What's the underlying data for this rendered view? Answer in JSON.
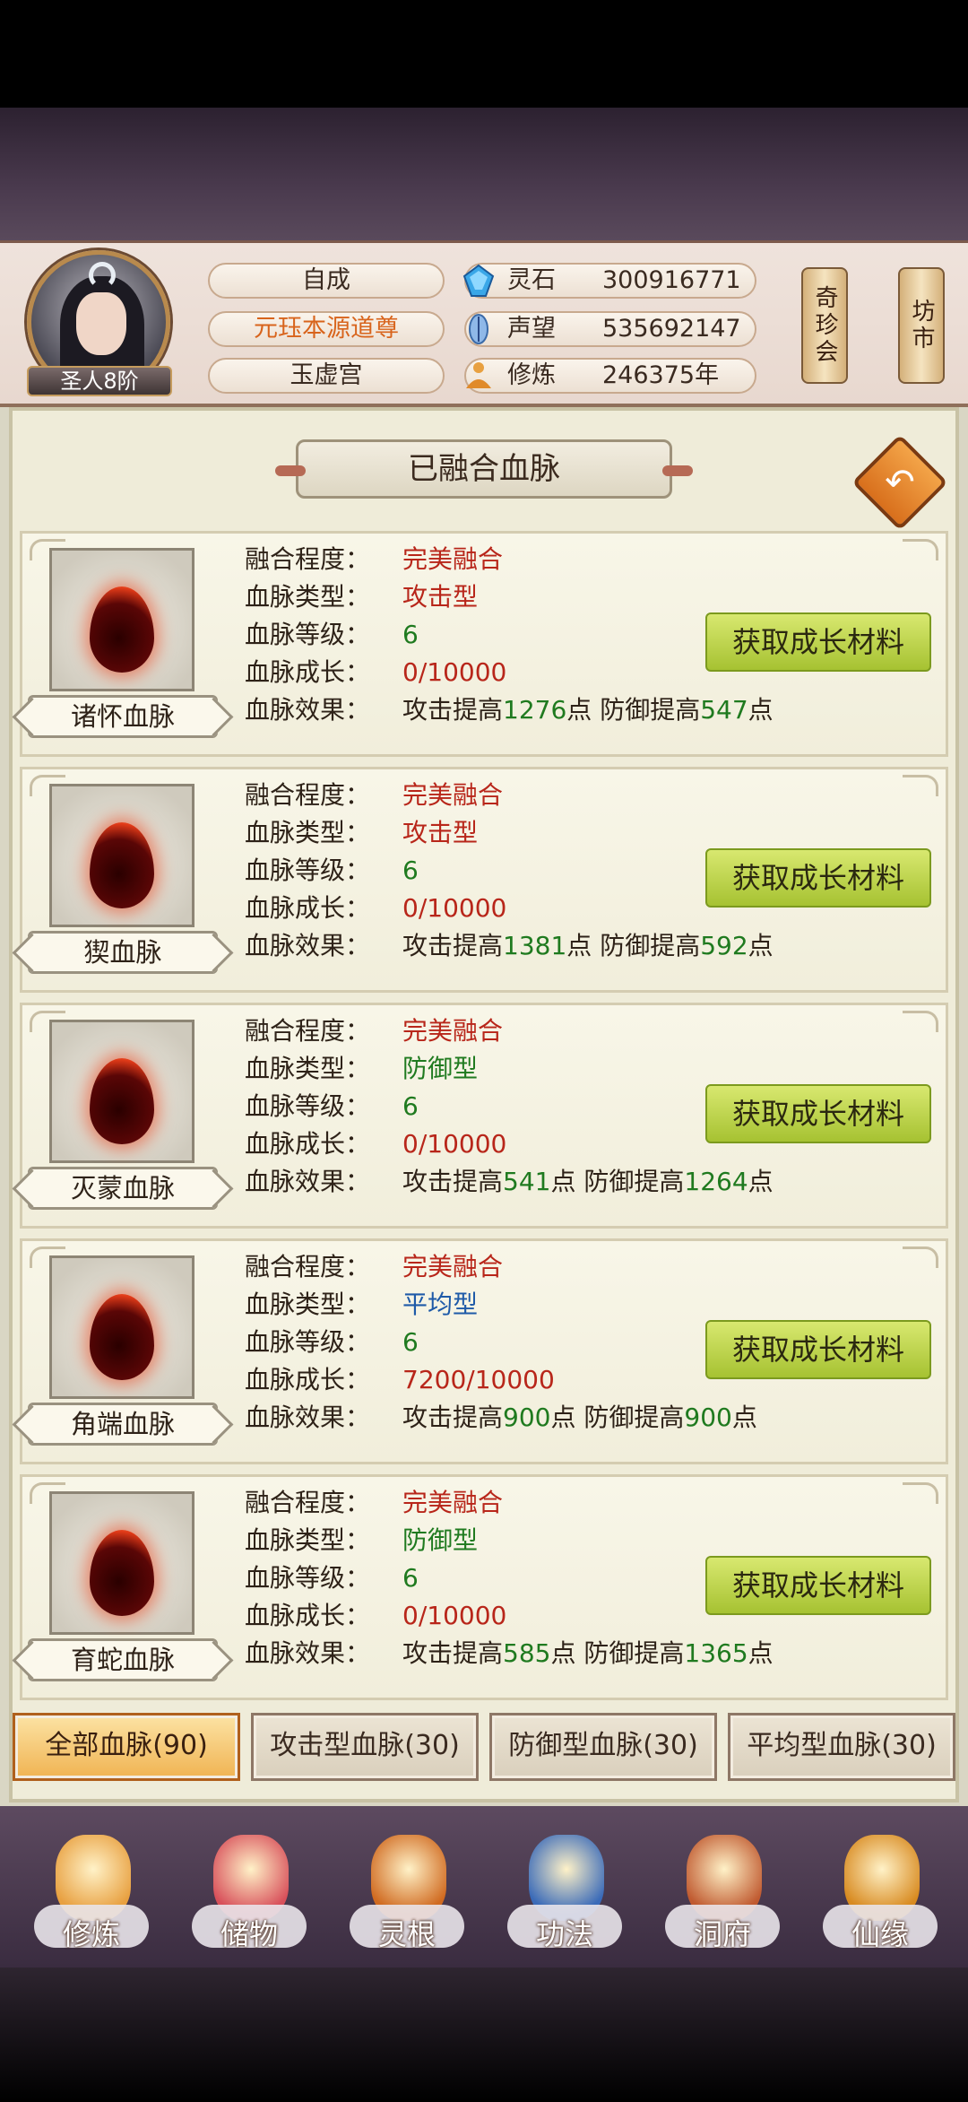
{
  "header": {
    "rank": "圣人8阶",
    "info_rows": [
      "自成",
      "元珏本源道尊",
      "玉虚宫"
    ],
    "stats": [
      {
        "icon": "spirit-stone-icon",
        "label": "灵石",
        "value": "300916771"
      },
      {
        "icon": "reputation-icon",
        "label": "声望",
        "value": "535692147"
      },
      {
        "icon": "cultivation-icon",
        "label": "修炼",
        "value": "246375年"
      }
    ],
    "side_buttons": [
      "奇珍会",
      "坊市"
    ]
  },
  "panel": {
    "title": "已融合血脉",
    "back_icon": "back-arrow-icon",
    "field_labels": {
      "fusion": "融合程度：",
      "type": "血脉类型：",
      "level": "血脉等级：",
      "growth": "血脉成长：",
      "effect": "血脉效果："
    },
    "get_button_label": "获取成长材料",
    "effect_words": {
      "atk_prefix": "攻击提高",
      "def_prefix": "防御提高",
      "unit": "点"
    }
  },
  "bloodlines": [
    {
      "name": "诸怀血脉",
      "fusion": "完美融合",
      "type": "攻击型",
      "type_color": "red",
      "level": "6",
      "growth": "0/10000",
      "atk": "1276",
      "def": "547"
    },
    {
      "name": "猰血脉",
      "fusion": "完美融合",
      "type": "攻击型",
      "type_color": "red",
      "level": "6",
      "growth": "0/10000",
      "atk": "1381",
      "def": "592"
    },
    {
      "name": "灭蒙血脉",
      "fusion": "完美融合",
      "type": "防御型",
      "type_color": "green",
      "level": "6",
      "growth": "0/10000",
      "atk": "541",
      "def": "1264"
    },
    {
      "name": "角端血脉",
      "fusion": "完美融合",
      "type": "平均型",
      "type_color": "blue",
      "level": "6",
      "growth": "7200/10000",
      "atk": "900",
      "def": "900"
    },
    {
      "name": "育蛇血脉",
      "fusion": "完美融合",
      "type": "防御型",
      "type_color": "green",
      "level": "6",
      "growth": "0/10000",
      "atk": "585",
      "def": "1365"
    }
  ],
  "tabs": [
    {
      "label": "全部血脉(90)",
      "active": true
    },
    {
      "label": "攻击型血脉(30)",
      "active": false
    },
    {
      "label": "防御型血脉(30)",
      "active": false
    },
    {
      "label": "平均型血脉(30)",
      "active": false
    }
  ],
  "bottom_nav": [
    {
      "label": "修炼",
      "icon": "meditation-icon",
      "color": "#e8a040"
    },
    {
      "label": "储物",
      "icon": "bag-icon",
      "color": "#d8505a"
    },
    {
      "label": "灵根",
      "icon": "spirit-root-icon",
      "color": "#d06a20"
    },
    {
      "label": "功法",
      "icon": "book-icon",
      "color": "#3a6ab8"
    },
    {
      "label": "洞府",
      "icon": "cave-house-icon",
      "color": "#c05a30"
    },
    {
      "label": "仙缘",
      "icon": "gourd-icon",
      "color": "#d88a20"
    }
  ]
}
